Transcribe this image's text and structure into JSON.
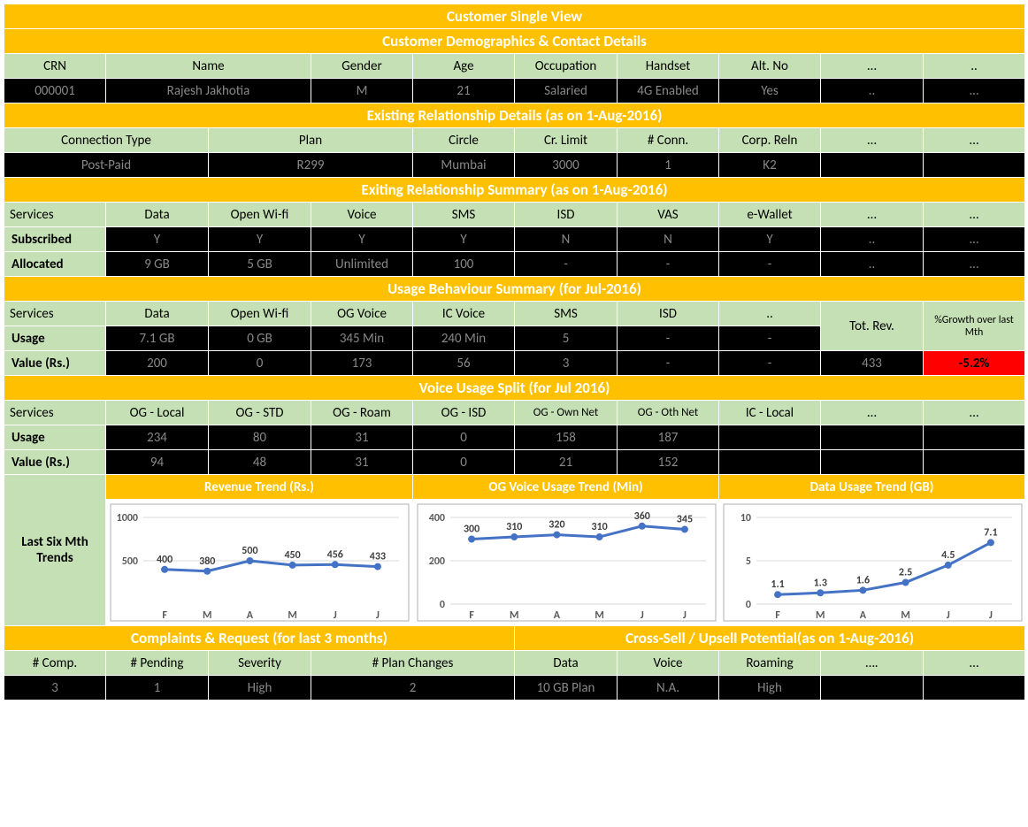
{
  "title": "Customer Single View",
  "section1": {
    "title": "Customer Demographics & Contact Details",
    "headers": [
      "CRN",
      "Name",
      "Gender",
      "Age",
      "Occupation",
      "Handset",
      "Alt. No",
      "…",
      ".."
    ],
    "values": [
      "000001",
      "Rajesh Jakhotia",
      "M",
      "21",
      "Salaried",
      "4G Enabled",
      "Yes",
      "..",
      "…"
    ]
  },
  "section2": {
    "title": "Existing Relationship Details (as on 1-Aug-2016)",
    "headers": [
      "Connection Type",
      "Plan",
      "Circle",
      "Cr. Limit",
      "# Conn.",
      "Corp. Reln",
      "…",
      "…"
    ],
    "values": [
      "Post-Paid",
      "R299",
      "Mumbai",
      "3000",
      "1",
      "K2",
      "",
      ""
    ]
  },
  "section3": {
    "title": "Exiting Relationship Summary (as on 1-Aug-2016)",
    "headers": [
      "Services",
      "Data",
      "Open Wi-fi",
      "Voice",
      "SMS",
      "ISD",
      "VAS",
      "e-Wallet",
      "…",
      "…"
    ],
    "row1_lbl": "Subscribed",
    "row1": [
      "Y",
      "Y",
      "Y",
      "Y",
      "N",
      "N",
      "Y",
      "..",
      "…"
    ],
    "row2_lbl": "Allocated",
    "row2": [
      "9 GB",
      "5 GB",
      "Unlimited",
      "100",
      "-",
      "-",
      "-",
      "..",
      "…"
    ]
  },
  "section4": {
    "title": "Usage Behaviour Summary (for Jul-2016)",
    "headers": [
      "Services",
      "Data",
      "Open Wi-fi",
      "OG Voice",
      "IC Voice",
      "SMS",
      "ISD",
      "..",
      "Tot. Rev.",
      "%Growth over last Mth"
    ],
    "row1_lbl": "Usage",
    "row1": [
      "7.1 GB",
      "0 GB",
      "345 Min",
      "240 Min",
      "5",
      "-",
      "-"
    ],
    "row2_lbl": "Value (Rs.)",
    "row2": [
      "200",
      "0",
      "173",
      "56",
      "3",
      "-",
      "-",
      "433"
    ],
    "growth": "-5.2%"
  },
  "section5": {
    "title": "Voice Usage Split (for Jul 2016)",
    "headers": [
      "Services",
      "OG - Local",
      "OG - STD",
      "OG - Roam",
      "OG - ISD",
      "OG - Own Net",
      "OG - Oth Net",
      "IC - Local",
      "…",
      "…"
    ],
    "row1_lbl": "Usage",
    "row1": [
      "234",
      "80",
      "31",
      "0",
      "158",
      "187",
      "",
      "",
      ""
    ],
    "row2_lbl": "Value (Rs.)",
    "row2": [
      "94",
      "48",
      "31",
      "0",
      "21",
      "152",
      "",
      "",
      ""
    ]
  },
  "trends_label": "Last Six Mth Trends",
  "chart_titles": [
    "Revenue Trend (Rs.)",
    "OG Voice Usage Trend (Min)",
    "Data Usage Trend (GB)"
  ],
  "section6a": {
    "title": "Complaints & Request (for last 3 months)",
    "headers": [
      "# Comp.",
      "# Pending",
      "Severity",
      "# Plan Changes"
    ],
    "values": [
      "3",
      "1",
      "High",
      "2"
    ]
  },
  "section6b": {
    "title": "Cross-Sell / Upsell Potential(as on 1-Aug-2016)",
    "headers": [
      "Data",
      "Voice",
      "Roaming",
      "….",
      "…"
    ],
    "values": [
      "10 GB Plan",
      "N.A.",
      "High",
      "",
      ""
    ]
  },
  "chart_data": [
    {
      "type": "line",
      "title": "Revenue Trend (Rs.)",
      "categories": [
        "F",
        "M",
        "A",
        "M",
        "J",
        "J"
      ],
      "values": [
        400,
        380,
        500,
        450,
        456,
        433
      ],
      "ylim": [
        0,
        1000
      ],
      "yticks": [
        500,
        1000
      ]
    },
    {
      "type": "line",
      "title": "OG Voice Usage Trend (Min)",
      "categories": [
        "F",
        "M",
        "A",
        "M",
        "J",
        "J"
      ],
      "values": [
        300,
        310,
        320,
        310,
        360,
        345
      ],
      "ylim": [
        0,
        400
      ],
      "yticks": [
        0,
        200,
        400
      ]
    },
    {
      "type": "line",
      "title": "Data Usage Trend (GB)",
      "categories": [
        "F",
        "M",
        "A",
        "M",
        "J",
        "J"
      ],
      "values": [
        1.1,
        1.3,
        1.6,
        2.5,
        4.5,
        7.1
      ],
      "ylim": [
        0,
        10
      ],
      "yticks": [
        0,
        5,
        10
      ]
    }
  ]
}
